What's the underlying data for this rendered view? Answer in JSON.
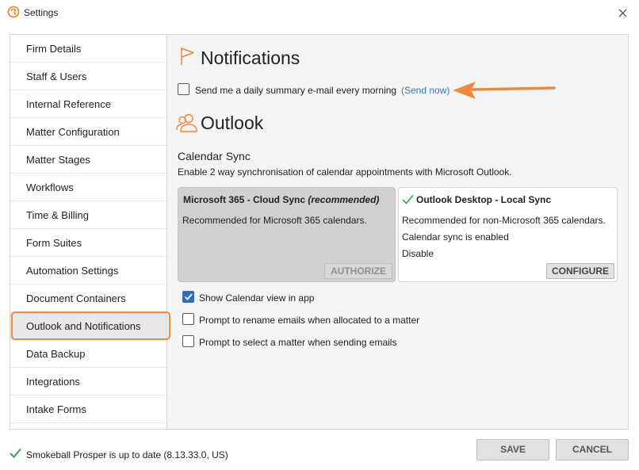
{
  "window": {
    "title": "Settings",
    "close_icon": "close-icon",
    "logo_icon": "smokeball-logo"
  },
  "sidebar": {
    "items": [
      {
        "label": "Firm Details"
      },
      {
        "label": "Staff & Users"
      },
      {
        "label": "Internal Reference"
      },
      {
        "label": "Matter Configuration"
      },
      {
        "label": "Matter Stages"
      },
      {
        "label": "Workflows"
      },
      {
        "label": "Time & Billing"
      },
      {
        "label": "Form Suites"
      },
      {
        "label": "Automation Settings"
      },
      {
        "label": "Document Containers"
      },
      {
        "label": "Outlook and Notifications",
        "selected": true
      },
      {
        "label": "Data Backup"
      },
      {
        "label": "Integrations"
      },
      {
        "label": "Intake Forms"
      }
    ]
  },
  "notifications": {
    "heading": "Notifications",
    "icon": "flag-icon",
    "daily_summary_label": "Send me a daily summary e-mail every morning",
    "daily_summary_checked": false,
    "send_now_link": "(Send now)"
  },
  "outlook": {
    "heading": "Outlook",
    "icon": "users-icon",
    "calendar_sync_title": "Calendar Sync",
    "calendar_sync_desc": "Enable 2 way synchronisation of calendar appointments with Microsoft Outlook.",
    "cloud_card": {
      "title": "Microsoft 365 - Cloud Sync",
      "title_suffix": "(recommended)",
      "desc": "Recommended for Microsoft 365 calendars.",
      "button": "AUTHORIZE"
    },
    "desktop_card": {
      "title": "Outlook Desktop - Local Sync",
      "status_icon": "checkmark-icon",
      "desc": "Recommended for non-Microsoft 365 calendars.",
      "status": "Calendar sync is enabled",
      "disable_link": "Disable",
      "button": "CONFIGURE"
    },
    "options": [
      {
        "label": "Show Calendar view in app",
        "checked": true
      },
      {
        "label": "Prompt to rename emails when allocated to a matter",
        "checked": false
      },
      {
        "label": "Prompt to select a matter when sending emails",
        "checked": false
      }
    ]
  },
  "footer": {
    "status_icon": "checkmark-icon",
    "status_text": "Smokeball Prosper is up to date (8.13.33.0, US)",
    "save_label": "SAVE",
    "cancel_label": "CANCEL"
  },
  "colors": {
    "accent_orange": "#f0883e",
    "link_blue": "#2f7abf",
    "check_green": "#3aa04a",
    "checkbox_blue": "#2f6fb8"
  }
}
